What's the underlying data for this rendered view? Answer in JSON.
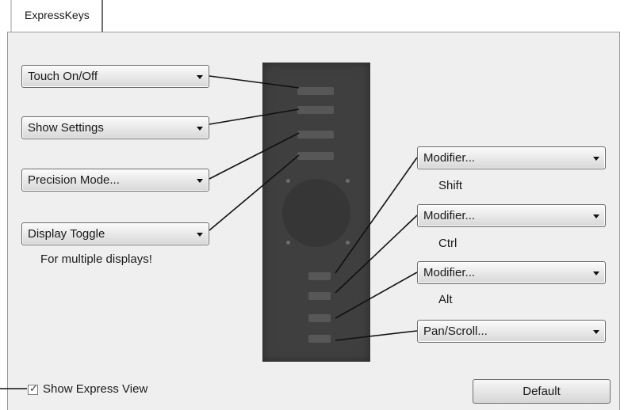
{
  "tabs": [
    {
      "label": "ExpressKeys"
    }
  ],
  "left_dropdowns": [
    {
      "value": "Touch On/Off"
    },
    {
      "value": "Show Settings"
    },
    {
      "value": "Precision Mode..."
    },
    {
      "value": "Display Toggle"
    }
  ],
  "display_note": "For multiple displays!",
  "right_dropdowns": [
    {
      "value": "Modifier...",
      "sublabel": "Shift"
    },
    {
      "value": "Modifier...",
      "sublabel": "Ctrl"
    },
    {
      "value": "Modifier...",
      "sublabel": "Alt"
    },
    {
      "value": "Pan/Scroll...",
      "sublabel": ""
    }
  ],
  "show_express_view": {
    "label": "Show Express View",
    "checked": true
  },
  "default_button": {
    "label": "Default"
  },
  "icons": {
    "dropdown_arrow": "chevron-down-icon",
    "checkmark": "checkmark-icon"
  },
  "colors": {
    "device": "#3f3f3f",
    "panel": "#efefef"
  }
}
